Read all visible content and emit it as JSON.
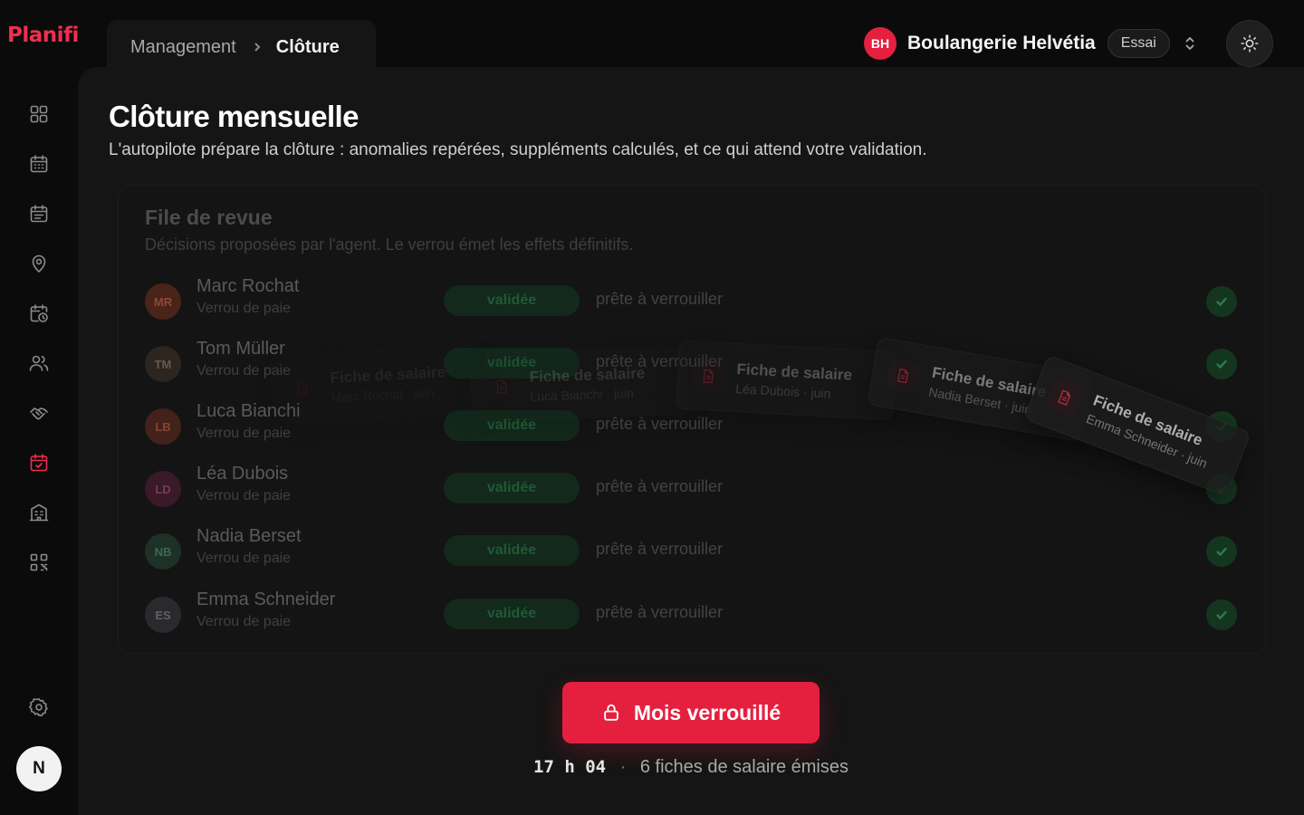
{
  "app": {
    "logo": "Planifi"
  },
  "breadcrumb": {
    "parent": "Management",
    "current": "Clôture"
  },
  "org": {
    "initials": "BH",
    "name": "Boulangerie Helvétia",
    "badge": "Essai",
    "avatar_color": "#e5203f"
  },
  "page": {
    "title": "Clôture mensuelle",
    "subtitle": "L'autopilote prépare la clôture : anomalies repérées, suppléments calculés, et ce qui attend votre validation."
  },
  "review": {
    "title": "File de revue",
    "subtitle": "Décisions proposées par l'agent. Le verrou émet les effets définitifs.",
    "rows": [
      {
        "initials": "MR",
        "name": "Marc Rochat",
        "sub": "Verrou de paie",
        "badge": "validée",
        "status": "prête à verrouiller",
        "color": "#4a2419",
        "text_color": "#8a4a38"
      },
      {
        "initials": "TM",
        "name": "Tom Müller",
        "sub": "Verrou de paie",
        "badge": "validée",
        "status": "prête à verrouiller",
        "color": "#2c2520",
        "text_color": "#6a5a4c"
      },
      {
        "initials": "LB",
        "name": "Luca Bianchi",
        "sub": "Verrou de paie",
        "badge": "validée",
        "status": "prête à verrouiller",
        "color": "#43221b",
        "text_color": "#864634"
      },
      {
        "initials": "LD",
        "name": "Léa Dubois",
        "sub": "Verrou de paie",
        "badge": "validée",
        "status": "prête à verrouiller",
        "color": "#3a1a28",
        "text_color": "#7a3a5a"
      },
      {
        "initials": "NB",
        "name": "Nadia Berset",
        "sub": "Verrou de paie",
        "badge": "validée",
        "status": "prête à verrouiller",
        "color": "#1e3127",
        "text_color": "#3e6a52"
      },
      {
        "initials": "ES",
        "name": "Emma Schneider",
        "sub": "Verrou de paie",
        "badge": "validée",
        "status": "prête à verrouiller",
        "color": "#2a2a2e",
        "text_color": "#5e5e66"
      }
    ]
  },
  "slips": [
    {
      "title": "Fiche de salaire",
      "sub": "Marc Rochat · juin"
    },
    {
      "title": "Fiche de salaire",
      "sub": "Luca Bianchi · juin"
    },
    {
      "title": "Fiche de salaire",
      "sub": "Léa Dubois · juin"
    },
    {
      "title": "Fiche de salaire",
      "sub": "Nadia Berset · juin"
    },
    {
      "title": "Fiche de salaire",
      "sub": "Emma Schneider · juin"
    }
  ],
  "lock": {
    "label": "Mois verrouillé"
  },
  "footer": {
    "time": "17 h 04",
    "separator": "·",
    "summary": "6 fiches de salaire émises"
  },
  "sidebar_icons": [
    "dashboard-icon",
    "calendar-icon",
    "schedule-icon",
    "location-icon",
    "calendar-clock-icon",
    "team-icon",
    "handshake-icon",
    "payroll-close-icon",
    "building-icon",
    "qr-code-icon",
    "settings-icon"
  ],
  "user": {
    "initial": "N"
  },
  "colors": {
    "accent": "#e5203f",
    "logo": "#ee2f4e",
    "validated": "#1f5a34"
  }
}
